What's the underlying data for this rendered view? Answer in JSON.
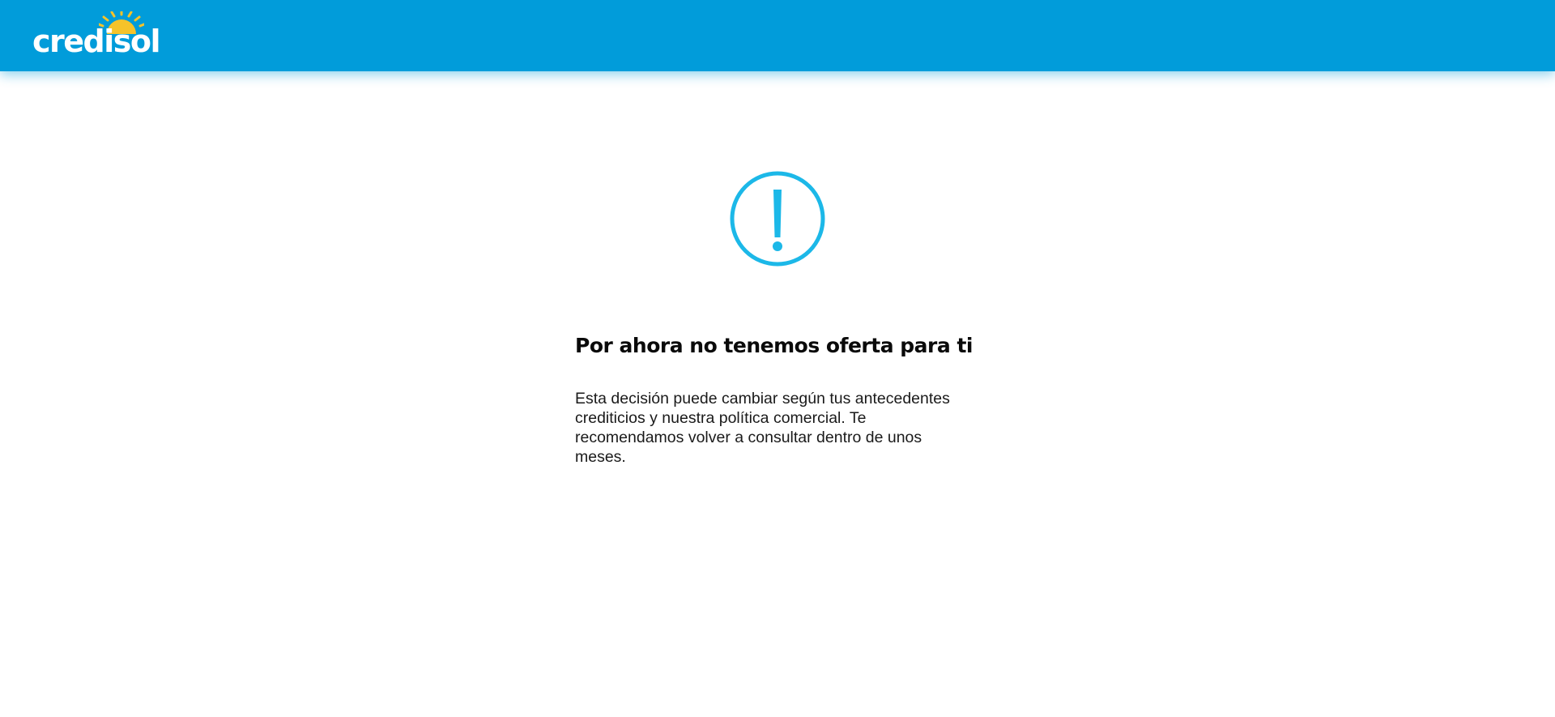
{
  "header": {
    "brand": "credisol",
    "background_color": "#019cda"
  },
  "logo": {
    "sun_color": "#f5c32a"
  },
  "message": {
    "icon": "exclamation-circle-icon",
    "icon_color": "#1cb8e8",
    "title": "Por ahora no tenemos oferta para ti",
    "description": "Esta decisión puede cambiar según tus antecedentes crediticios y nuestra política comercial. Te recomendamos volver a consultar dentro de unos meses."
  }
}
